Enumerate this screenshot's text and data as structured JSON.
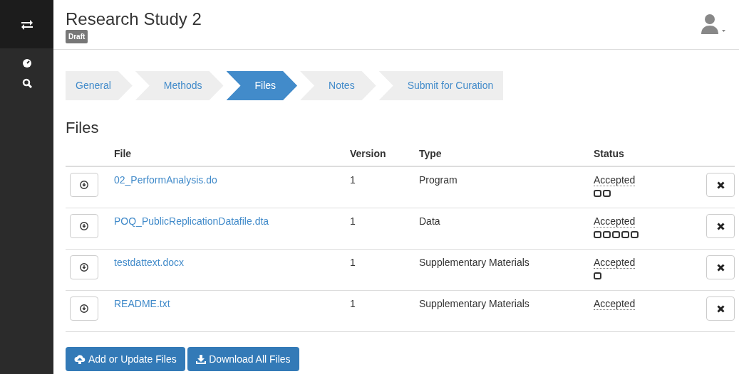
{
  "header": {
    "title": "Research Study 2",
    "badge": "Draft"
  },
  "steps": [
    {
      "label": "General",
      "selected": false
    },
    {
      "label": "Methods",
      "selected": false
    },
    {
      "label": "Files",
      "selected": true
    },
    {
      "label": "Notes",
      "selected": false
    },
    {
      "label": "Submit for Curation",
      "selected": false
    }
  ],
  "section_title": "Files",
  "table": {
    "columns": [
      "File",
      "Version",
      "Type",
      "Status"
    ],
    "rows": [
      {
        "file": "02_PerformAnalysis.do",
        "version": "1",
        "type": "Program",
        "status": "Accepted",
        "markers": [
          {
            "kind": "square"
          },
          {
            "kind": "square"
          }
        ]
      },
      {
        "file": "POQ_PublicReplicationDatafile.dta",
        "version": "1",
        "type": "Data",
        "status": "Accepted",
        "markers": [
          {
            "kind": "square"
          },
          {
            "kind": "square"
          },
          {
            "kind": "square"
          },
          {
            "kind": "square"
          },
          {
            "kind": "square"
          }
        ]
      },
      {
        "file": "testdattext.docx",
        "version": "1",
        "type": "Supplementary Materials",
        "status": "Accepted",
        "markers": [
          {
            "kind": "square"
          }
        ]
      },
      {
        "file": "README.txt",
        "version": "1",
        "type": "Supplementary Materials",
        "status": "Accepted",
        "markers": []
      }
    ]
  },
  "buttons": [
    {
      "label": "Add or Update Files",
      "kind": "upload"
    },
    {
      "label": "Download All Files",
      "kind": "download"
    }
  ]
}
